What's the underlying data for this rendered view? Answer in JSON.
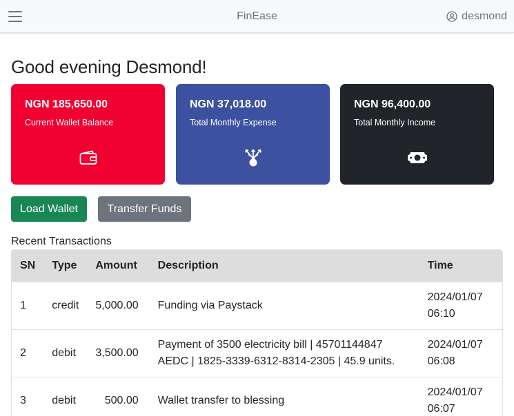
{
  "navbar": {
    "brand": "FinEase",
    "username": "desmond"
  },
  "greeting": "Good evening Desmond!",
  "cards": [
    {
      "amount": "NGN 185,650.00",
      "label": "Current Wallet Balance",
      "icon": "wallet-icon",
      "color": "#f10032"
    },
    {
      "amount": "NGN 37,018.00",
      "label": "Total Monthly Expense",
      "icon": "money-bag-outflow-icon",
      "color": "#3c51a0"
    },
    {
      "amount": "NGN 96,400.00",
      "label": "Total Monthly Income",
      "icon": "cash-icon",
      "color": "#212529"
    }
  ],
  "buttons": {
    "load_wallet": "Load Wallet",
    "transfer_funds": "Transfer Funds"
  },
  "transactions": {
    "title": "Recent Transactions",
    "headers": [
      "SN",
      "Type",
      "Amount",
      "Description",
      "Time"
    ],
    "rows": [
      {
        "sn": "1",
        "type": "credit",
        "amount": "5,000.00",
        "desc_line1": "Funding via Paystack",
        "desc_line2": "",
        "time_date": "2024/01/07",
        "time_clock": "06:10"
      },
      {
        "sn": "2",
        "type": "debit",
        "amount": "3,500.00",
        "desc_line1": "Payment of 3500 electricity bill | 45701144847",
        "desc_line2": "AEDC | 1825-3339-6312-8314-2305 | 45.9 units.",
        "time_date": "2024/01/07",
        "time_clock": "06:08"
      },
      {
        "sn": "3",
        "type": "debit",
        "amount": "500.00",
        "desc_line1": "Wallet transfer to blessing",
        "desc_line2": "",
        "time_date": "2024/01/07",
        "time_clock": "06:07"
      }
    ]
  }
}
